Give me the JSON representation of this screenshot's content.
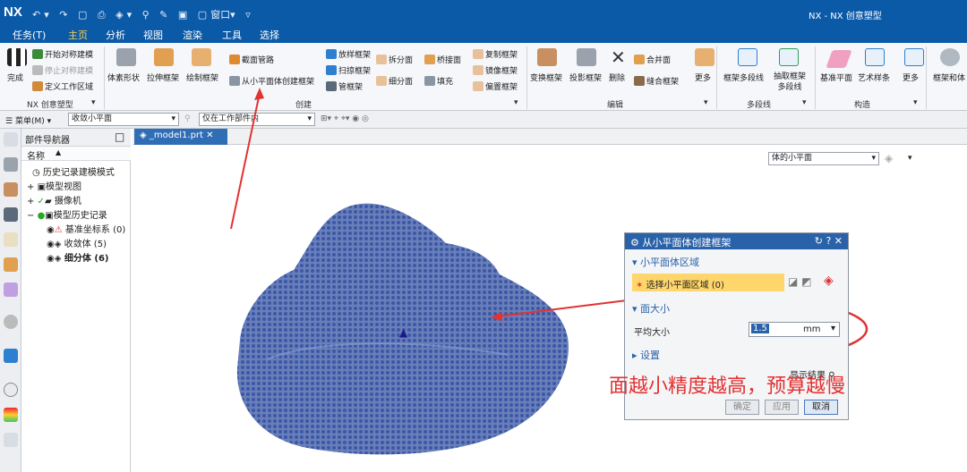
{
  "app": {
    "logo": "NX",
    "window_title": "NX - NX 创意塑型",
    "window_menu": "窗口"
  },
  "menus": [
    "任务(T)",
    "主页",
    "分析",
    "视图",
    "渲染",
    "工具",
    "选择"
  ],
  "active_menu": "主页",
  "ribbon": {
    "nx_group": {
      "items": [
        "开始对称建模",
        "停止对称建模",
        "定义工作区域"
      ],
      "done": "完成",
      "label": "NX 创意塑型"
    },
    "create_group": {
      "label": "创建",
      "big": [
        "体素形状",
        "拉伸框架",
        "绘制框架"
      ],
      "small": [
        "截面管路",
        "从小平面体创建框架",
        "放样框架",
        "扫掠框架",
        "管框架",
        "拆分面",
        "细分面",
        "桥接面",
        "填充",
        "复制框架",
        "镜像框架",
        "偏置框架"
      ]
    },
    "edit_group": {
      "label": "编辑",
      "big": [
        "变换框架",
        "投影框架",
        "删除"
      ],
      "small": [
        "合并面",
        "缝合框架"
      ],
      "more": "更多"
    },
    "polyline_group": {
      "label": "多段线",
      "big": [
        "框架多段线",
        "抽取框架多段线"
      ]
    },
    "construct_group": {
      "label": "构造",
      "big": [
        "基准平面",
        "艺术样条",
        "更多"
      ],
      "extra": "框架和体"
    }
  },
  "toolbar2": {
    "menu": "菜单(M)",
    "filter": "收敛小平面",
    "scope": "仅在工作部件内"
  },
  "navigator": {
    "title": "部件导航器",
    "col_name": "名称",
    "items": [
      "历史记录建模模式",
      "模型视图",
      "摄像机",
      "模型历史记录",
      "基准坐标系 (0)",
      "收敛体 (5)",
      "细分体 (6)"
    ]
  },
  "tab": {
    "name": "_model1.prt"
  },
  "viewport": {
    "selection_combo": "体的小平面"
  },
  "dialog": {
    "title": "从小平面体创建框架",
    "section1": "小平面体区域",
    "select_label": "选择小平面区域 (0)",
    "section2": "面大小",
    "avg_label": "平均大小",
    "avg_value": "1.5",
    "unit": "mm",
    "section3": "设置",
    "show_result": "显示结果",
    "ok": "确定",
    "apply": "应用",
    "cancel": "取消"
  },
  "annotation": "面越小精度越高，预算越慢"
}
